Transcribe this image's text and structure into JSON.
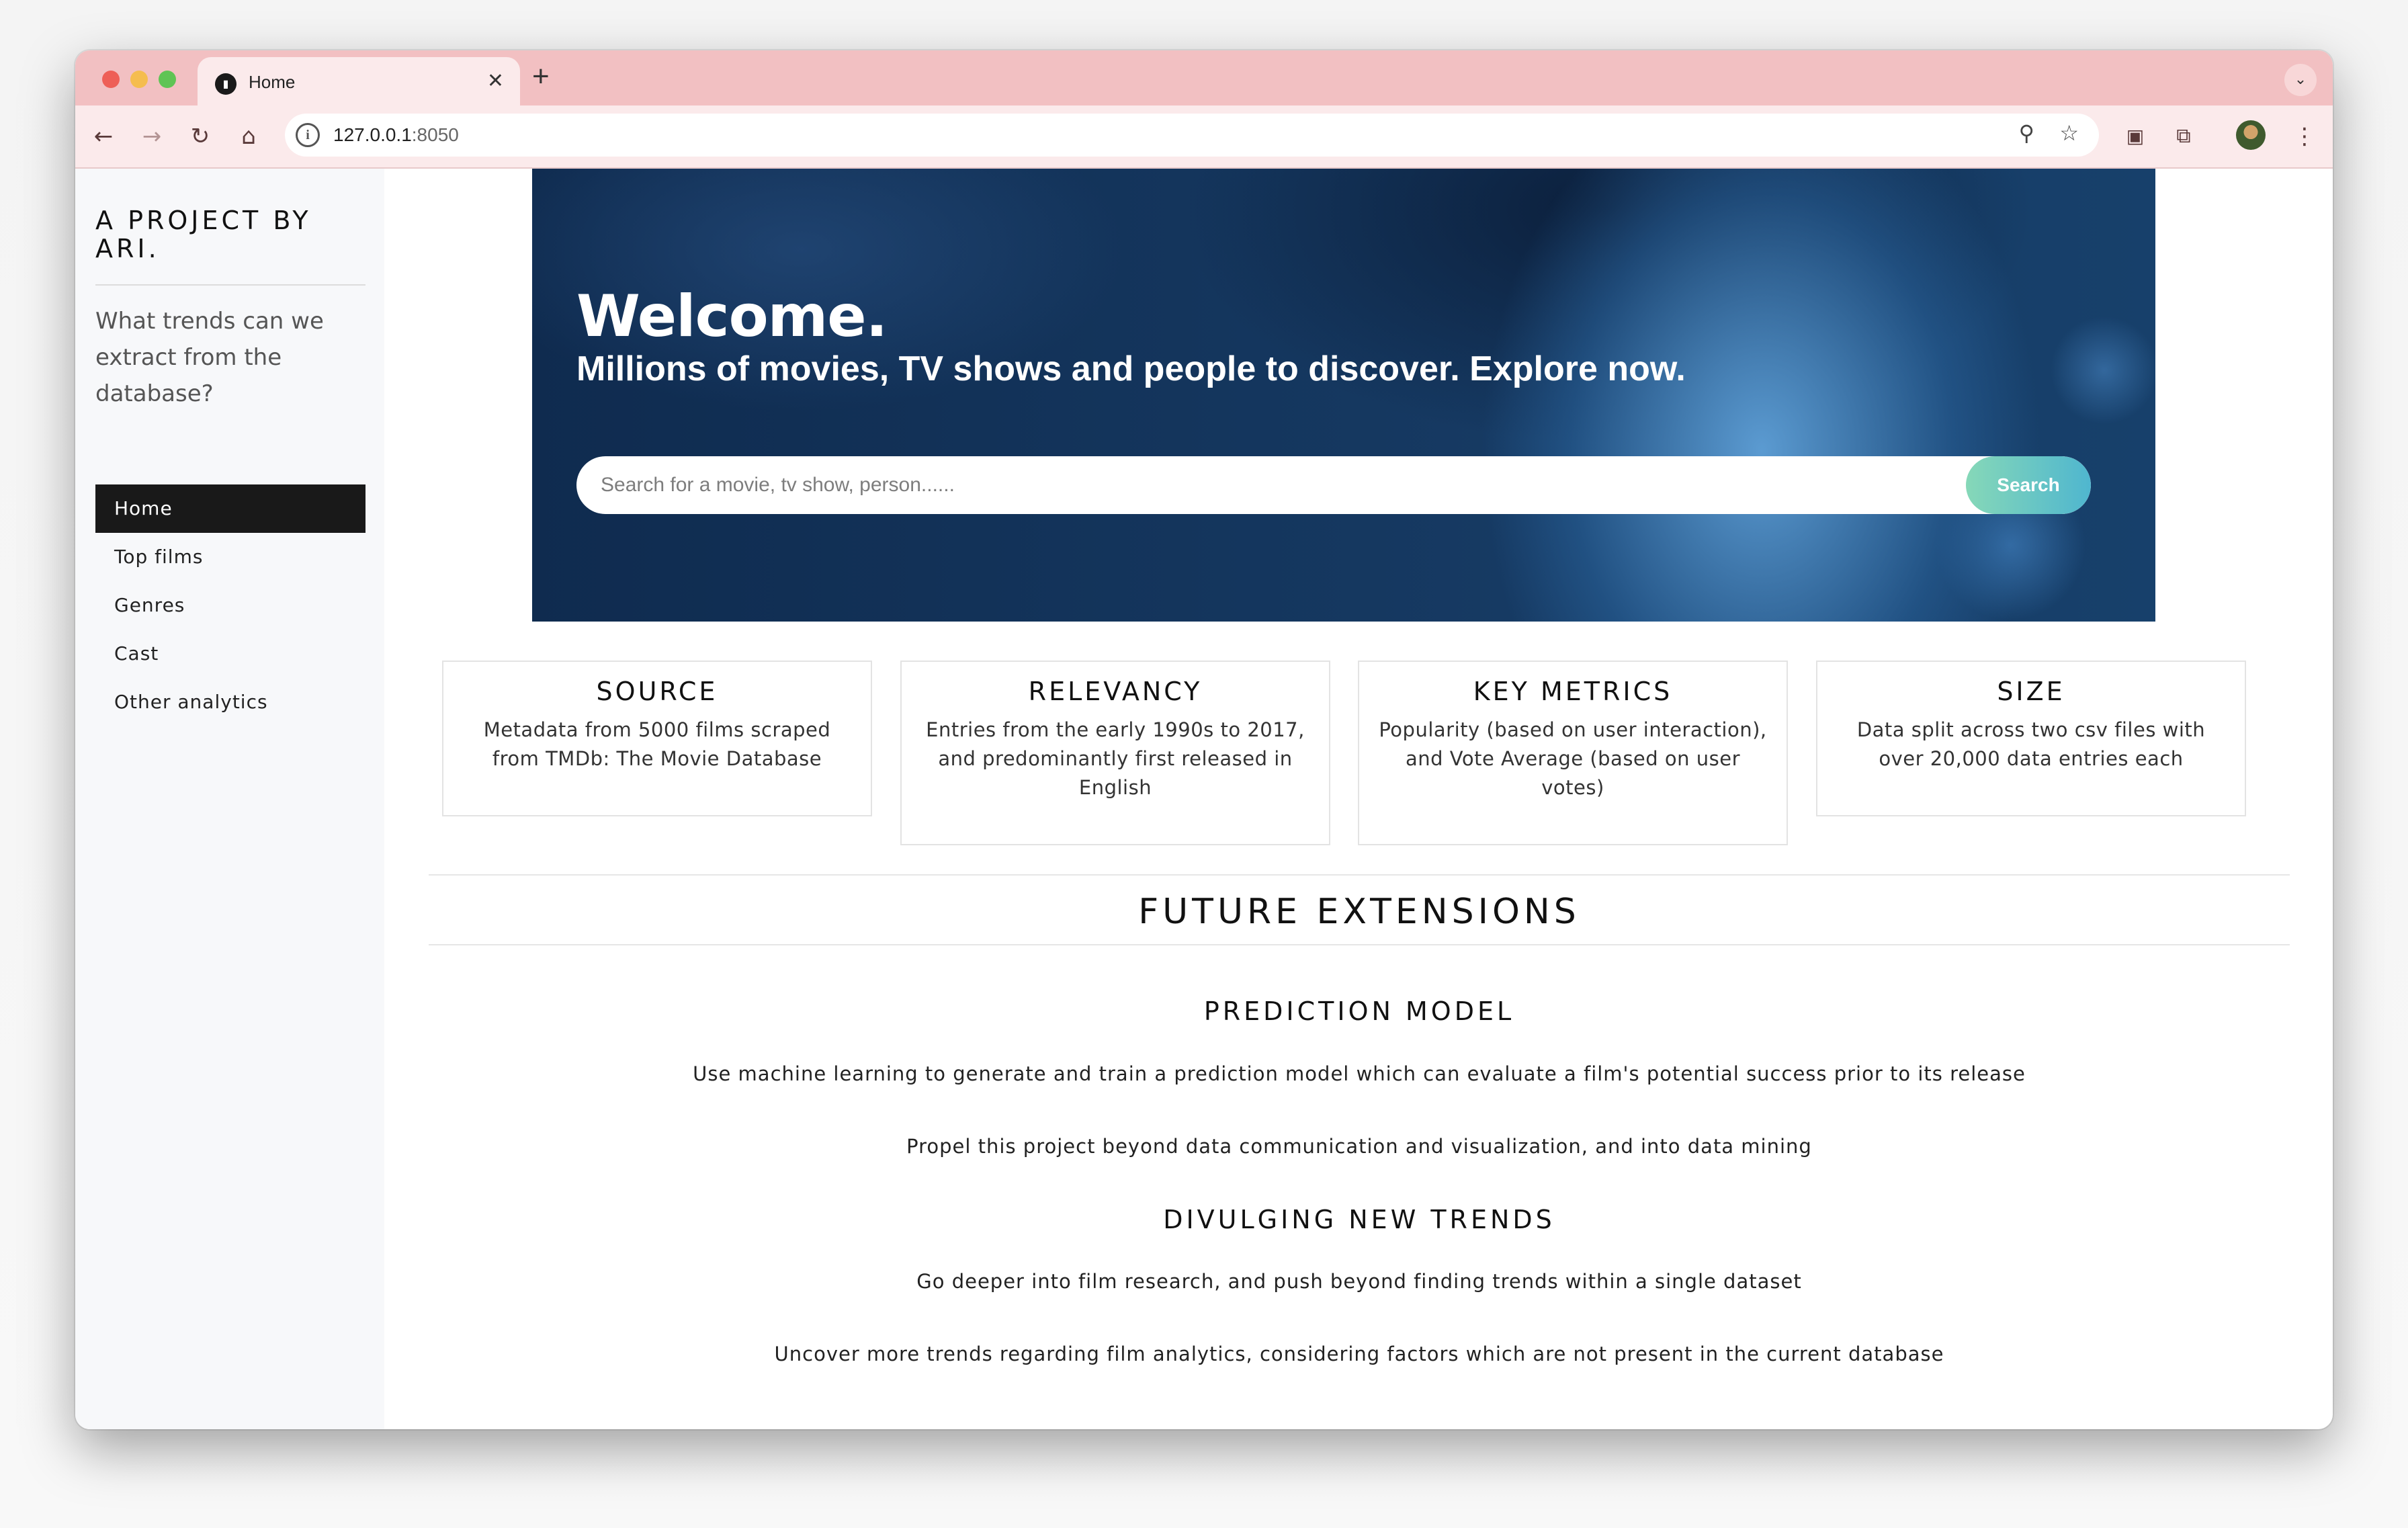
{
  "browser": {
    "tab_title": "Home",
    "url_host": "127.0.0.1",
    "url_port": ":8050"
  },
  "sidebar": {
    "brand": "A PROJECT BY ARI.",
    "tagline": "What trends can we extract from the database?",
    "nav": [
      {
        "label": "Home",
        "active": true
      },
      {
        "label": "Top films",
        "active": false
      },
      {
        "label": "Genres",
        "active": false
      },
      {
        "label": "Cast",
        "active": false
      },
      {
        "label": "Other analytics",
        "active": false
      }
    ]
  },
  "hero": {
    "title": "Welcome.",
    "subtitle": "Millions of movies, TV shows and people to discover. Explore now.",
    "search_placeholder": "Search for a movie, tv show, person......",
    "search_button": "Search"
  },
  "cards": [
    {
      "title": "SOURCE",
      "text": "Metadata from 5000 films scraped from TMDb: The Movie Database"
    },
    {
      "title": "RELEVANCY",
      "text": "Entries from the early 1990s to 2017, and predominantly first released in English"
    },
    {
      "title": "KEY METRICS",
      "text": "Popularity (based on user interaction), and Vote Average (based on user votes)"
    },
    {
      "title": "SIZE",
      "text": "Data split across two csv files with over 20,000 data entries each"
    }
  ],
  "future": {
    "title": "FUTURE EXTENSIONS",
    "prediction": {
      "title": "PREDICTION MODEL",
      "p1": "Use machine learning to generate and train a prediction model which can evaluate a film's potential success prior to its release",
      "p2": "Propel this project beyond data communication and visualization, and into data mining"
    },
    "trends": {
      "title": "DIVULGING NEW TRENDS",
      "p1": "Go deeper into film research, and push beyond finding trends within a single dataset",
      "p2": "Uncover more trends regarding film analytics, considering factors which are not present in the current database"
    }
  },
  "colors": {
    "tab_strip": "#f2c0c2",
    "nav_active": "#191919",
    "hero_bg": "#163a63",
    "search_button": "#4fb6cf"
  }
}
